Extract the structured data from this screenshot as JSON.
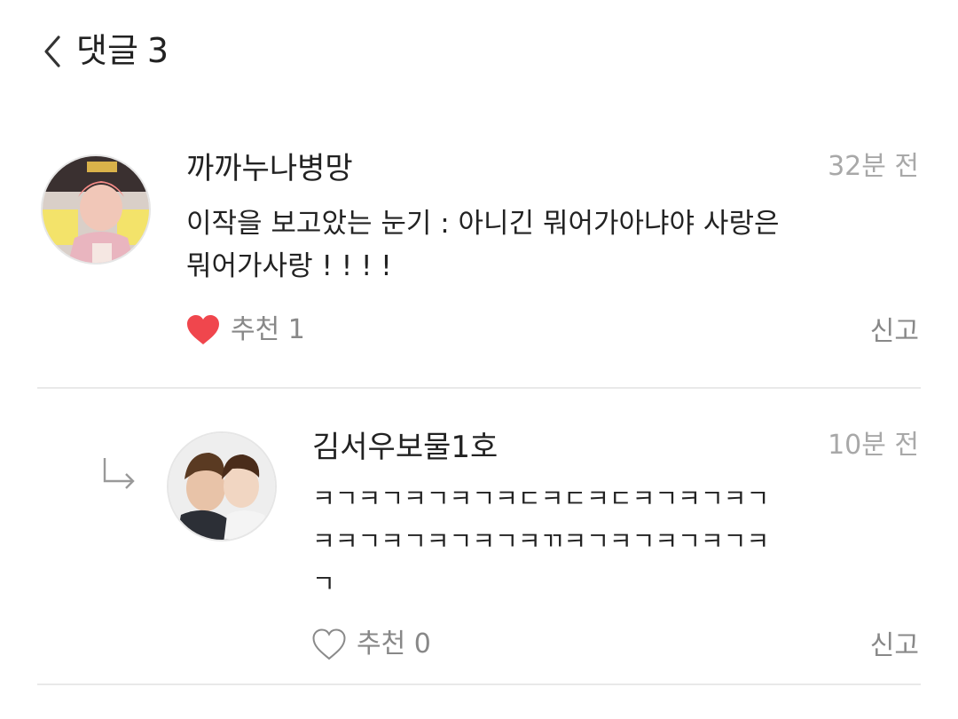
{
  "header": {
    "title": "댓글",
    "count": "3",
    "back_icon": "chevron-left-icon"
  },
  "comments": [
    {
      "author": "까까누나병망",
      "time": "32분 전",
      "body": "이작을 보고았는 눈기 : 아니긴 뭐어가아냐야 사랑은\n뭐어가사랑 ! ! ! !",
      "liked": true,
      "like_label": "추천 1",
      "report_label": "신고",
      "heart_color": "#f0464d",
      "is_reply": false
    },
    {
      "author": "김서우보물1호",
      "time": "10분 전",
      "body": "ㅋㄱㅋㄱㅋㄱㅋㄱㅋㄷㅋㄷㅋㄷㅋㄱㅋㄱㅋㄱ\nㅋㅋㄱㅋㄱㅋㄱㅋㄱㅋㄲㅋㄱㅋㄱㅋㄱㅋㄱㅋ\nㄱ",
      "liked": false,
      "like_label": "추천 0",
      "report_label": "신고",
      "is_reply": true
    }
  ]
}
